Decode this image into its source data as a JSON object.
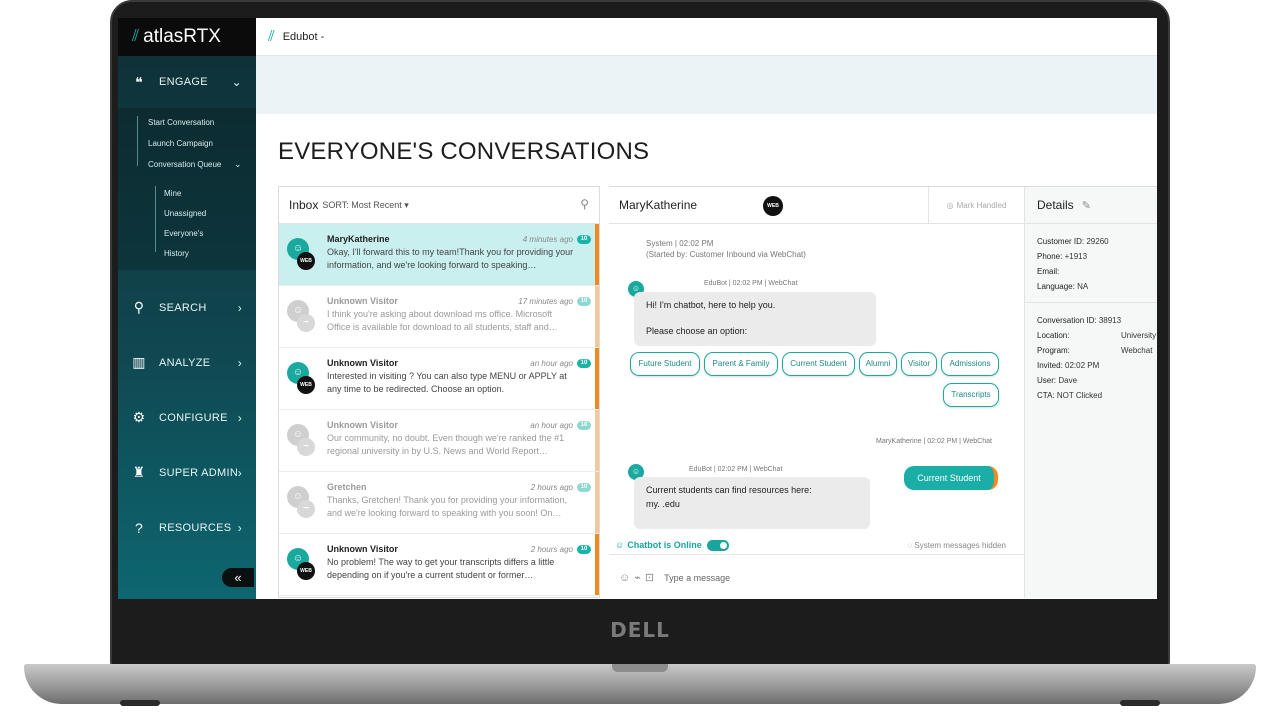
{
  "device": {
    "brand": "DELL"
  },
  "sidebar": {
    "brand": "atlasRTX",
    "sections": [
      {
        "label": "ENGAGE"
      },
      {
        "label": "SEARCH"
      },
      {
        "label": "ANALYZE"
      },
      {
        "label": "CONFIGURE"
      },
      {
        "label": "SUPER ADMIN"
      },
      {
        "label": "RESOURCES"
      }
    ],
    "engage_items": [
      "Start Conversation",
      "Launch Campaign",
      "Conversation Queue"
    ],
    "queue_items": [
      "Mine",
      "Unassigned",
      "Everyone's",
      "History"
    ],
    "collapse_glyph": "«"
  },
  "header": {
    "bot_name": "Edubot -"
  },
  "page": {
    "title": "EVERYONE'S CONVERSATIONS"
  },
  "inbox": {
    "title": "Inbox",
    "sort_label": "SORT: Most Recent",
    "conversations": [
      {
        "name": "MaryKatherine",
        "time": "4 minutes ago",
        "badge": "10",
        "preview": "Okay, I'll forward this to my team!Thank you for providing your information, and we're looking forward to speaking…"
      },
      {
        "name": "Unknown Visitor",
        "time": "17 minutes ago",
        "badge": "10",
        "preview": "I think you're asking about download ms office. Microsoft Office is available for download to all students, staff and…"
      },
      {
        "name": "Unknown Visitor",
        "time": "an hour ago",
        "badge": "10",
        "preview": "Interested in visiting            ? You can also type MENU or APPLY at any time to be redirected. Choose an option."
      },
      {
        "name": "Unknown Visitor",
        "time": "an hour ago",
        "badge": "10",
        "preview": "Our community, no doubt. Even though we're ranked the #1 regional university in        by U.S. News and World Report…"
      },
      {
        "name": "Gretchen",
        "time": "2 hours ago",
        "badge": "10",
        "preview": "Thanks, Gretchen! Thank you for providing your information, and we're looking forward to speaking with you soon! On…"
      },
      {
        "name": "Unknown Visitor",
        "time": "2 hours ago",
        "badge": "10",
        "preview": "No problem! The way to get your transcripts differs a little depending on if you're a current student or former…"
      }
    ]
  },
  "chat": {
    "contact": "MaryKatherine",
    "channel_badge": "WEB",
    "mark_handled": "Mark Handled",
    "system_line1": "System | 02:02 PM",
    "system_line2": "(Started by: Customer Inbound via WebChat)",
    "bot_meta1": "EduBot | 02:02 PM | WebChat",
    "bot_msg1_line1": "Hi! I'm                chatbot,           here to help you.",
    "bot_msg1_line2": "Please choose an option:",
    "options": [
      "Future Student",
      "Parent & Family",
      "Current Student",
      "Alumni",
      "Visitor",
      "Admissions",
      "Transcripts"
    ],
    "user_meta": "MaryKatherine | 02:02 PM | WebChat",
    "user_msg": "Current Student",
    "bot_meta2": "EduBot          | 02:02 PM | WebChat",
    "bot_msg2_line1": "Current students can find resources here:",
    "bot_msg2_line2": "my.            .edu",
    "online_status": "Chatbot is Online",
    "system_hidden": "System messages hidden",
    "composer_placeholder": "Type a message"
  },
  "details": {
    "title": "Details",
    "customer": [
      {
        "label": "Customer ID:",
        "value": "29260"
      },
      {
        "label": "Phone:",
        "value": "+1913"
      },
      {
        "label": "Email:",
        "value": ""
      },
      {
        "label": "Language:",
        "value": "NA"
      }
    ],
    "conversation": [
      {
        "label": "Conversation ID:",
        "value": "38913"
      },
      {
        "label": "Location:",
        "value": "University"
      },
      {
        "label": "Program:",
        "value": "Webchat"
      },
      {
        "label": "Invited:",
        "value": "02:02 PM"
      },
      {
        "label": "User:",
        "value": "Dave"
      },
      {
        "label": "CTA:",
        "value": "NOT Clicked"
      }
    ]
  },
  "colors": {
    "accent": "#19b3aa",
    "unread_bar": "#ef8a22",
    "sidebar_dark": "#0f2f36"
  }
}
